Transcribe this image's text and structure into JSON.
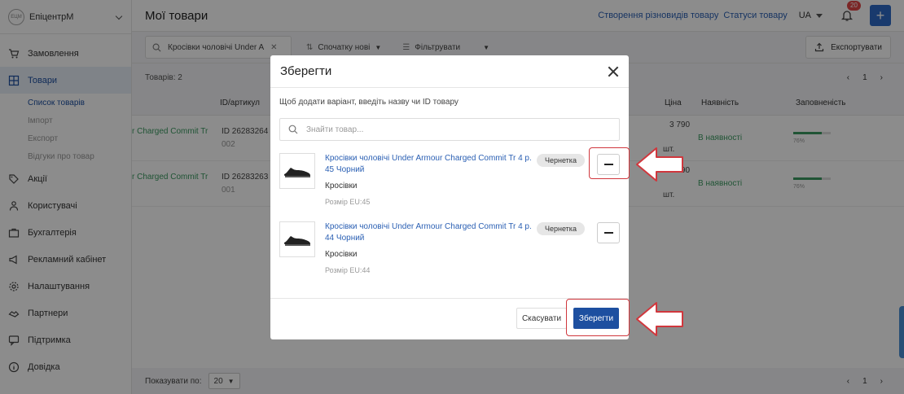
{
  "brand": {
    "logo_text": "ЕЦМ",
    "name": "ЕпіцентрМ"
  },
  "sidebar": {
    "items": [
      {
        "label": "Замовлення",
        "icon": "cart-icon"
      },
      {
        "label": "Товари",
        "icon": "grid-icon",
        "active": true
      },
      {
        "label": "Акції",
        "icon": "tag-icon"
      },
      {
        "label": "Користувачі",
        "icon": "users-icon"
      },
      {
        "label": "Бухгалтерія",
        "icon": "briefcase-icon"
      },
      {
        "label": "Рекламний кабінет",
        "icon": "megaphone-icon"
      },
      {
        "label": "Налаштування",
        "icon": "gear-icon"
      },
      {
        "label": "Партнери",
        "icon": "handshake-icon"
      },
      {
        "label": "Підтримка",
        "icon": "chat-icon"
      },
      {
        "label": "Довідка",
        "icon": "info-icon"
      }
    ],
    "sub_items": [
      "Список товарів",
      "Імпорт",
      "Експорт",
      "Відгуки про товар"
    ]
  },
  "header": {
    "title": "Мої товари",
    "link_variants": "Створення різновидів товару",
    "link_statuses": "Статуси товару",
    "language": "UA",
    "notifications": "20"
  },
  "toolbar": {
    "search_value": "Кросівки чоловічі Under A",
    "sort_label": "Спочатку нові",
    "filter_label": "Фільтрувати",
    "export_label": "Експортувати"
  },
  "list": {
    "count_label": "Товарів: 2",
    "page": "1",
    "headers": {
      "id": "ID/артикул",
      "price": "Ціна",
      "availability": "Наявність",
      "fill": "Заповненість"
    },
    "rows": [
      {
        "name": "r Charged Commit Tr",
        "id": "ID 26283264",
        "code": "002",
        "price": "3 790",
        "unit": "шт.",
        "availability": "В наявності",
        "fill_pct": "76%",
        "fill_value": 76
      },
      {
        "name": "r Charged Commit Tr",
        "id": "ID 26283263",
        "code": "001",
        "price": "3 790",
        "unit": "шт.",
        "availability": "В наявності",
        "fill_pct": "76%",
        "fill_value": 76
      }
    ],
    "per_page_label": "Показувати по:",
    "per_page_value": "20"
  },
  "modal": {
    "title": "Зберегти",
    "hint": "Щоб додати варіант, введіть назву чи ID товару",
    "search_placeholder": "Знайти товар...",
    "items": [
      {
        "title": "Кросівки чоловічі Under Armour Charged Commit Tr 4 р. 45 Чорний",
        "category": "Кросівки",
        "size": "Розмір EU:45",
        "status": "Чернетка"
      },
      {
        "title": "Кросівки чоловічі Under Armour Charged Commit Tr 4 р. 44 Чорний",
        "category": "Кросівки",
        "size": "Розмір EU:44",
        "status": "Чернетка"
      }
    ],
    "cancel_label": "Скасувати",
    "save_label": "Зберегти"
  },
  "colors": {
    "accent": "#1d4fa0",
    "success": "#3b9a61",
    "highlight": "#d0373d",
    "badge": "#e04545"
  }
}
